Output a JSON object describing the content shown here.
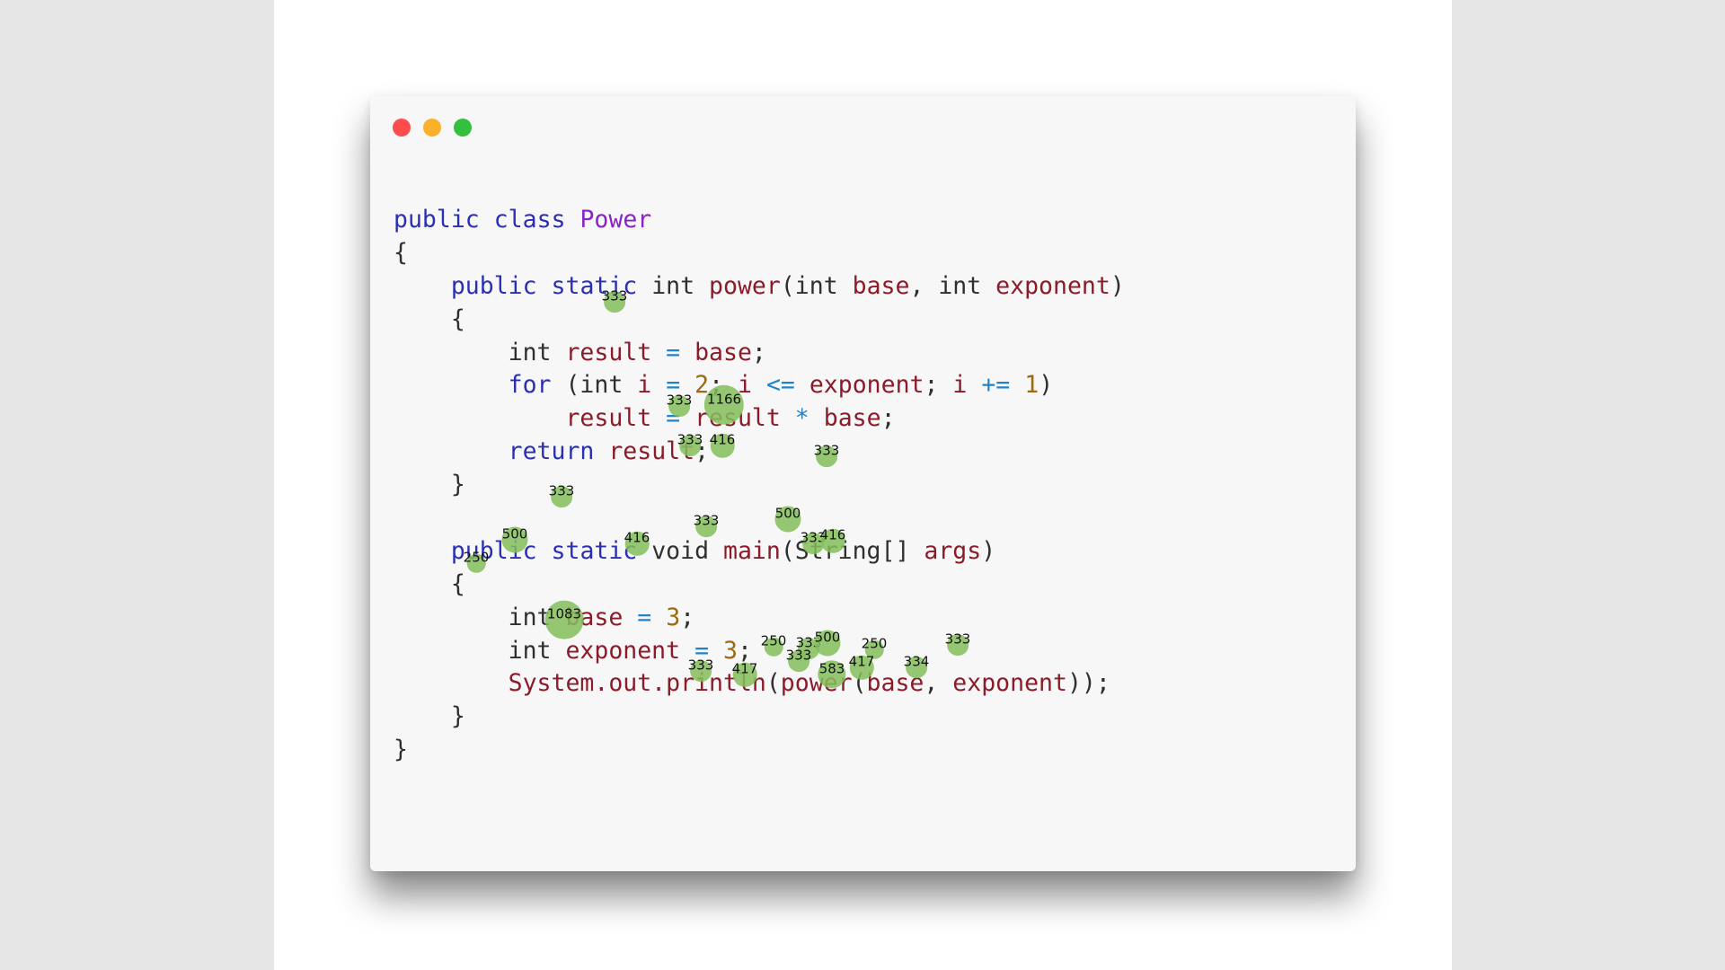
{
  "window": {
    "controls": [
      "close",
      "minimize",
      "maximize"
    ],
    "colors": {
      "close": "#fc4c4c",
      "minimize": "#f9b02b",
      "maximize": "#33c03f"
    }
  },
  "code": {
    "lines": [
      [
        {
          "t": "public",
          "c": "kw"
        },
        {
          "t": " ",
          "c": "plain"
        },
        {
          "t": "class",
          "c": "kw"
        },
        {
          "t": " ",
          "c": "plain"
        },
        {
          "t": "Power",
          "c": "cls"
        }
      ],
      [
        {
          "t": "{",
          "c": "plain"
        }
      ],
      [
        {
          "t": "    ",
          "c": "plain"
        },
        {
          "t": "public",
          "c": "kw"
        },
        {
          "t": " ",
          "c": "plain"
        },
        {
          "t": "static",
          "c": "kw"
        },
        {
          "t": " int ",
          "c": "plain"
        },
        {
          "t": "power",
          "c": "id"
        },
        {
          "t": "(int ",
          "c": "plain"
        },
        {
          "t": "base",
          "c": "id"
        },
        {
          "t": ", int ",
          "c": "plain"
        },
        {
          "t": "exponent",
          "c": "id"
        },
        {
          "t": ")",
          "c": "plain"
        }
      ],
      [
        {
          "t": "    {",
          "c": "plain"
        }
      ],
      [
        {
          "t": "        int ",
          "c": "plain"
        },
        {
          "t": "result",
          "c": "id"
        },
        {
          "t": " ",
          "c": "plain"
        },
        {
          "t": "=",
          "c": "op"
        },
        {
          "t": " ",
          "c": "plain"
        },
        {
          "t": "base",
          "c": "id"
        },
        {
          "t": ";",
          "c": "plain"
        }
      ],
      [
        {
          "t": "        ",
          "c": "plain"
        },
        {
          "t": "for",
          "c": "kw"
        },
        {
          "t": " (int ",
          "c": "plain"
        },
        {
          "t": "i",
          "c": "id"
        },
        {
          "t": " ",
          "c": "plain"
        },
        {
          "t": "=",
          "c": "op"
        },
        {
          "t": " ",
          "c": "plain"
        },
        {
          "t": "2",
          "c": "num"
        },
        {
          "t": "; ",
          "c": "plain"
        },
        {
          "t": "i",
          "c": "id"
        },
        {
          "t": " ",
          "c": "plain"
        },
        {
          "t": "<=",
          "c": "op"
        },
        {
          "t": " ",
          "c": "plain"
        },
        {
          "t": "exponent",
          "c": "id"
        },
        {
          "t": "; ",
          "c": "plain"
        },
        {
          "t": "i",
          "c": "id"
        },
        {
          "t": " ",
          "c": "plain"
        },
        {
          "t": "+=",
          "c": "op"
        },
        {
          "t": " ",
          "c": "plain"
        },
        {
          "t": "1",
          "c": "num"
        },
        {
          "t": ")",
          "c": "plain"
        }
      ],
      [
        {
          "t": "            ",
          "c": "plain"
        },
        {
          "t": "result",
          "c": "id"
        },
        {
          "t": " ",
          "c": "plain"
        },
        {
          "t": "=",
          "c": "op"
        },
        {
          "t": " ",
          "c": "plain"
        },
        {
          "t": "result",
          "c": "id"
        },
        {
          "t": " ",
          "c": "plain"
        },
        {
          "t": "*",
          "c": "op"
        },
        {
          "t": " ",
          "c": "plain"
        },
        {
          "t": "base",
          "c": "id"
        },
        {
          "t": ";",
          "c": "plain"
        }
      ],
      [
        {
          "t": "        ",
          "c": "plain"
        },
        {
          "t": "return",
          "c": "kw"
        },
        {
          "t": " ",
          "c": "plain"
        },
        {
          "t": "result",
          "c": "id"
        },
        {
          "t": ";",
          "c": "plain"
        }
      ],
      [
        {
          "t": "    }",
          "c": "plain"
        }
      ],
      [
        {
          "t": "",
          "c": "plain"
        }
      ],
      [
        {
          "t": "    ",
          "c": "plain"
        },
        {
          "t": "public",
          "c": "kw"
        },
        {
          "t": " ",
          "c": "plain"
        },
        {
          "t": "static",
          "c": "kw"
        },
        {
          "t": " void ",
          "c": "plain"
        },
        {
          "t": "main",
          "c": "id"
        },
        {
          "t": "(String[] ",
          "c": "plain"
        },
        {
          "t": "args",
          "c": "id"
        },
        {
          "t": ")",
          "c": "plain"
        }
      ],
      [
        {
          "t": "    {",
          "c": "plain"
        }
      ],
      [
        {
          "t": "        int ",
          "c": "plain"
        },
        {
          "t": "base",
          "c": "id"
        },
        {
          "t": " ",
          "c": "plain"
        },
        {
          "t": "=",
          "c": "op"
        },
        {
          "t": " ",
          "c": "plain"
        },
        {
          "t": "3",
          "c": "num"
        },
        {
          "t": ";",
          "c": "plain"
        }
      ],
      [
        {
          "t": "        int ",
          "c": "plain"
        },
        {
          "t": "exponent",
          "c": "id"
        },
        {
          "t": " ",
          "c": "plain"
        },
        {
          "t": "=",
          "c": "op"
        },
        {
          "t": " ",
          "c": "plain"
        },
        {
          "t": "3",
          "c": "num"
        },
        {
          "t": ";",
          "c": "plain"
        }
      ],
      [
        {
          "t": "        ",
          "c": "plain"
        },
        {
          "t": "System.out.println",
          "c": "id"
        },
        {
          "t": "(",
          "c": "plain"
        },
        {
          "t": "power",
          "c": "id"
        },
        {
          "t": "(",
          "c": "plain"
        },
        {
          "t": "base",
          "c": "id"
        },
        {
          "t": ", ",
          "c": "plain"
        },
        {
          "t": "exponent",
          "c": "id"
        },
        {
          "t": "));",
          "c": "plain"
        }
      ],
      [
        {
          "t": "    }",
          "c": "plain"
        }
      ],
      [
        {
          "t": "}",
          "c": "plain"
        }
      ]
    ]
  },
  "fixations": [
    {
      "label": "333",
      "value": 333
    },
    {
      "label": "333",
      "value": 333
    },
    {
      "label": "1166",
      "value": 1166
    },
    {
      "label": "333",
      "value": 333
    },
    {
      "label": "416",
      "value": 416
    },
    {
      "label": "333",
      "value": 333
    },
    {
      "label": "333",
      "value": 333
    },
    {
      "label": "333",
      "value": 333
    },
    {
      "label": "500",
      "value": 500
    },
    {
      "label": "500",
      "value": 500
    },
    {
      "label": "416",
      "value": 416
    },
    {
      "label": "333",
      "value": 333
    },
    {
      "label": "416",
      "value": 416
    },
    {
      "label": "250",
      "value": 250
    },
    {
      "label": "1083",
      "value": 1083
    },
    {
      "label": "250",
      "value": 250
    },
    {
      "label": "333",
      "value": 333
    },
    {
      "label": "500",
      "value": 500
    },
    {
      "label": "250",
      "value": 250
    },
    {
      "label": "333",
      "value": 333
    },
    {
      "label": "333",
      "value": 333
    },
    {
      "label": "333",
      "value": 333
    },
    {
      "label": "417",
      "value": 417
    },
    {
      "label": "583",
      "value": 583
    },
    {
      "label": "417",
      "value": 417
    },
    {
      "label": "334",
      "value": 334
    }
  ],
  "fixation_color": "#84be5c"
}
